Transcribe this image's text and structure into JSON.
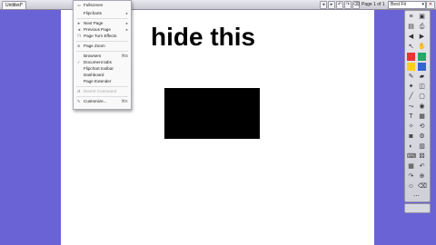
{
  "title_bar": {
    "document_tab": "Untitled*",
    "page_indicator": "Page 1 of 1",
    "zoom_value": "Best Fit"
  },
  "menu": {
    "items": [
      {
        "label": "Fullscreen",
        "shortcut": "",
        "icon": "fullscreen-icon"
      },
      {
        "label": "Flipcharts",
        "shortcut": "▸",
        "icon": ""
      },
      {
        "label": "Next Page",
        "shortcut": "▸",
        "icon": "next-page-icon"
      },
      {
        "label": "Previous Page",
        "shortcut": "▸",
        "icon": "previous-page-icon"
      },
      {
        "label": "Page Turn Effects",
        "shortcut": "",
        "icon": "page-turn-icon"
      },
      {
        "label": "Page Zoom",
        "shortcut": "",
        "icon": "zoom-icon"
      },
      {
        "label": "Browsers",
        "shortcut": "⌘B",
        "icon": ""
      },
      {
        "label": "Document tabs",
        "shortcut": "",
        "icon": "checkmark-icon"
      },
      {
        "label": "Flipchart toolbar",
        "shortcut": "",
        "icon": ""
      },
      {
        "label": "Dashboard",
        "shortcut": "",
        "icon": ""
      },
      {
        "label": "Page Extender",
        "shortcut": "",
        "icon": ""
      },
      {
        "label": "Revert Command",
        "shortcut": "",
        "icon": "revert-icon"
      },
      {
        "label": "Customize...",
        "shortcut": "⌘K",
        "icon": "customize-icon"
      }
    ]
  },
  "canvas": {
    "heading_text": "hide this"
  },
  "colors": {
    "desktop_bg": "#6a63d6",
    "page_bg": "#ffffff",
    "shape_fill": "#000000"
  }
}
